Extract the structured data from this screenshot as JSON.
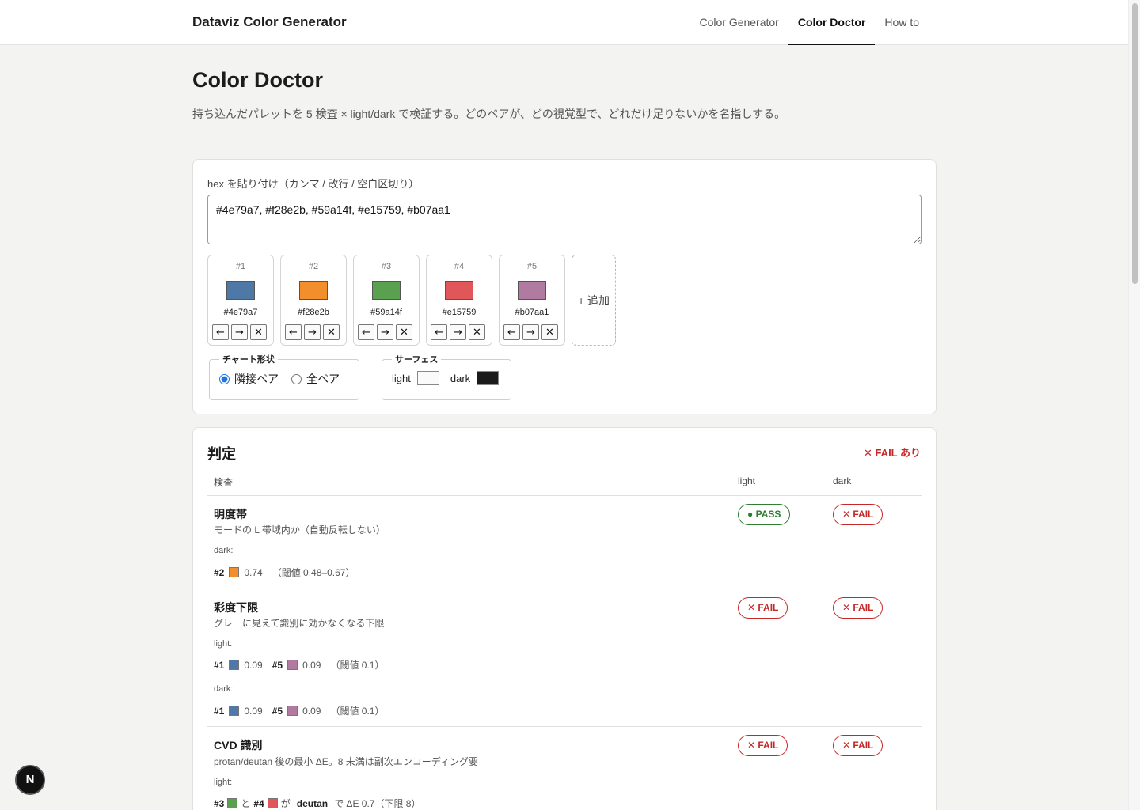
{
  "header": {
    "brand": "Dataviz Color Generator",
    "nav": [
      "Color Generator",
      "Color Doctor",
      "How to"
    ],
    "active_nav": "Color Doctor"
  },
  "page": {
    "title": "Color Doctor",
    "description": "持ち込んだパレットを 5 検査 × light/dark で検証する。どのペアが、どの視覚型で、どれだけ足りないかを名指しする。"
  },
  "input": {
    "label": "hex を貼り付け（カンマ / 改行 / 空白区切り）",
    "value": "#4e79a7, #f28e2b, #59a14f, #e15759, #b07aa1",
    "swatches": [
      {
        "index": "#1",
        "hex": "#4e79a7",
        "color": "#4e79a7"
      },
      {
        "index": "#2",
        "hex": "#f28e2b",
        "color": "#f28e2b"
      },
      {
        "index": "#3",
        "hex": "#59a14f",
        "color": "#59a14f"
      },
      {
        "index": "#4",
        "hex": "#e15759",
        "color": "#e15759"
      },
      {
        "index": "#5",
        "hex": "#b07aa1",
        "color": "#b07aa1"
      }
    ],
    "move_left": "←",
    "move_right": "→",
    "remove": "✕",
    "add_label": "+ 追加",
    "shape_legend": "チャート形状",
    "shape_options": [
      "隣接ペア",
      "全ペア"
    ],
    "shape_selected": "隣接ペア",
    "surface_legend": "サーフェス",
    "surface_light_label": "light",
    "surface_dark_label": "dark",
    "surface_light_color": "#fafafa",
    "surface_dark_color": "#1a1a1a"
  },
  "result": {
    "title": "判定",
    "overall": "✕ FAIL あり",
    "columns": [
      "検査",
      "light",
      "dark"
    ],
    "rows": [
      {
        "title": "明度帯",
        "subtitle": "モードの L 帯域内か（自動反転しない）",
        "light": "● PASS",
        "dark": "✕ FAIL",
        "details": [
          {
            "mode": "dark:",
            "items": [
              {
                "idx": "#2",
                "color": "#f28e2b",
                "value": "0.74"
              }
            ],
            "threshold": "（閾値 0.48–0.67）"
          }
        ]
      },
      {
        "title": "彩度下限",
        "subtitle": "グレーに見えて識別に効かなくなる下限",
        "light": "✕ FAIL",
        "dark": "✕ FAIL",
        "details": [
          {
            "mode": "light:",
            "items": [
              {
                "idx": "#1",
                "color": "#4e79a7",
                "value": "0.09"
              },
              {
                "idx": "#5",
                "color": "#b07aa1",
                "value": "0.09"
              }
            ],
            "threshold": "（閾値 0.1）"
          },
          {
            "mode": "dark:",
            "items": [
              {
                "idx": "#1",
                "color": "#4e79a7",
                "value": "0.09"
              },
              {
                "idx": "#5",
                "color": "#b07aa1",
                "value": "0.09"
              }
            ],
            "threshold": "（閾値 0.1）"
          }
        ]
      },
      {
        "title": "CVD 識別",
        "subtitle": "protan/deutan 後の最小 ΔE。8 未満は副次エンコーディング要",
        "light": "✕ FAIL",
        "dark": "✕ FAIL",
        "details": [
          {
            "mode": "light:",
            "pair": {
              "a": "#3",
              "a_color": "#59a14f",
              "and": "と",
              "b": "#4",
              "b_color": "#e15759",
              "ga": "が",
              "type": "deutan",
              "de": "で ΔE 0.7（下限 8）"
            }
          }
        ]
      }
    ]
  },
  "floating": {
    "next_badge": "N"
  }
}
